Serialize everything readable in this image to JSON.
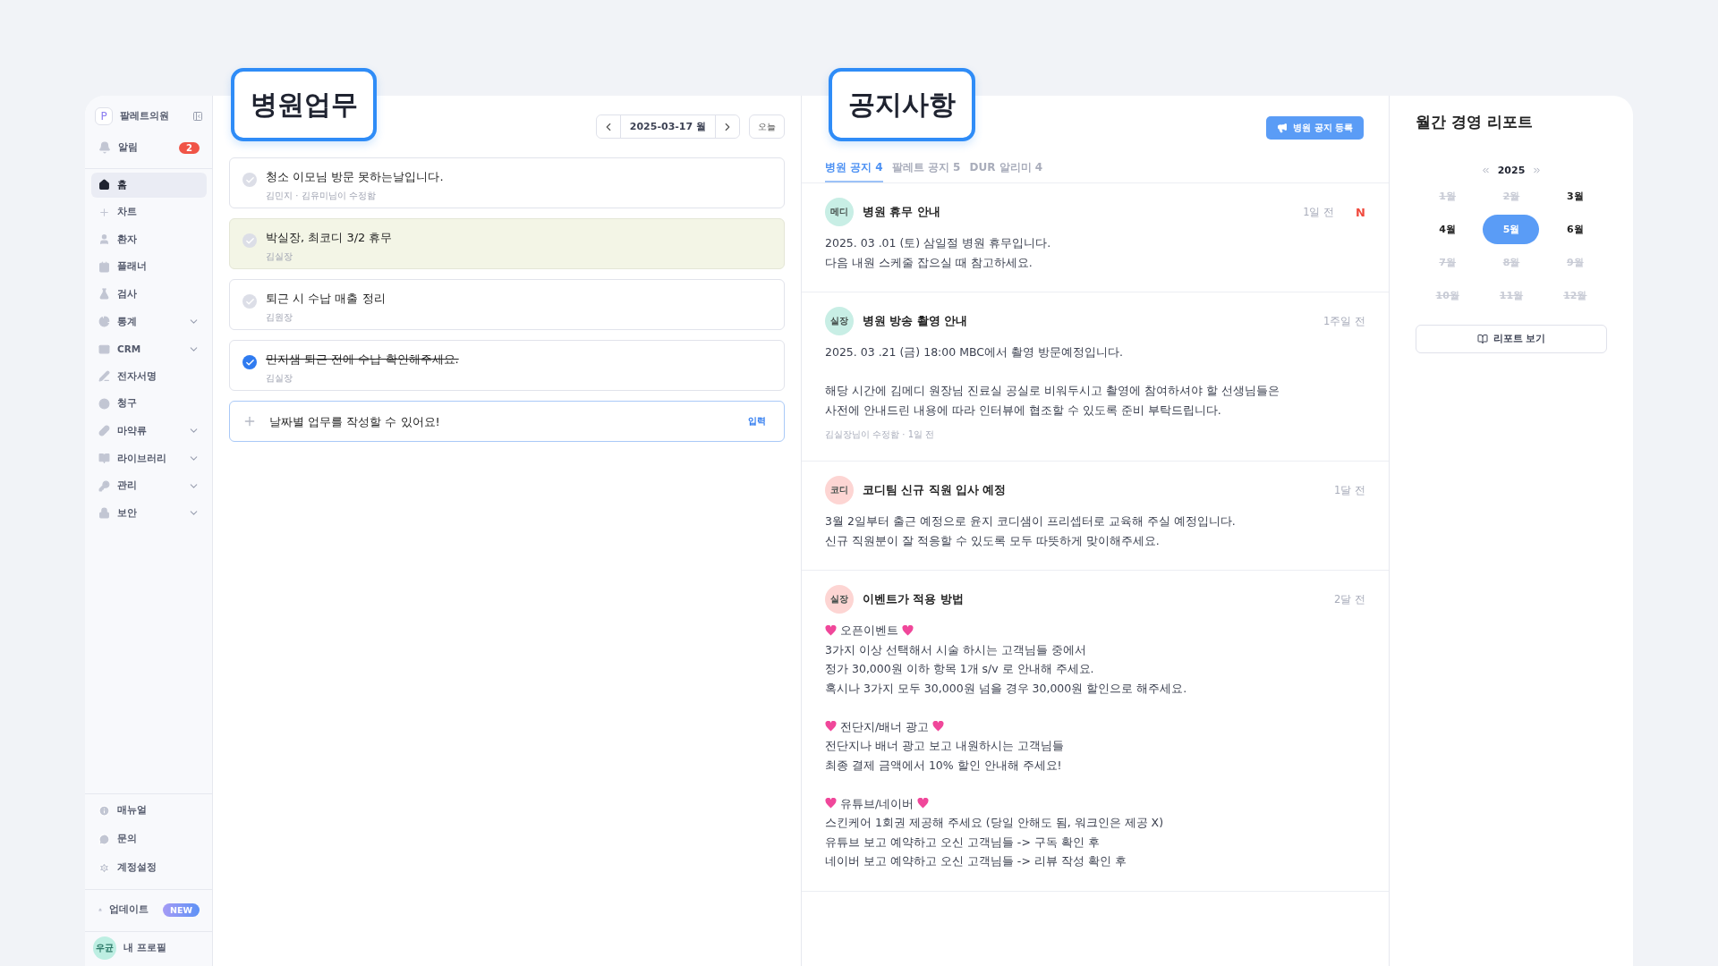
{
  "sidebar": {
    "clinic_name": "팔레트의원",
    "logo_letter": "P",
    "alert": {
      "label": "알림",
      "count": "2"
    },
    "items": [
      {
        "label": "홈",
        "selected": true,
        "expandable": false
      },
      {
        "label": "차트",
        "selected": false,
        "expandable": false
      },
      {
        "label": "환자",
        "selected": false,
        "expandable": false
      },
      {
        "label": "플래너",
        "selected": false,
        "expandable": false
      },
      {
        "label": "검사",
        "selected": false,
        "expandable": false
      },
      {
        "label": "통계",
        "selected": false,
        "expandable": true
      },
      {
        "label": "CRM",
        "selected": false,
        "expandable": true
      },
      {
        "label": "전자서명",
        "selected": false,
        "expandable": false
      },
      {
        "label": "청구",
        "selected": false,
        "expandable": false
      },
      {
        "label": "마약류",
        "selected": false,
        "expandable": true
      },
      {
        "label": "라이브러리",
        "selected": false,
        "expandable": true
      },
      {
        "label": "관리",
        "selected": false,
        "expandable": true
      },
      {
        "label": "보안",
        "selected": false,
        "expandable": true
      }
    ],
    "bottom_items": [
      {
        "label": "매뉴얼"
      },
      {
        "label": "문의"
      },
      {
        "label": "계정설정"
      }
    ],
    "update": {
      "label": "업데이트",
      "badge": "NEW"
    },
    "profile": {
      "avatar": "우균",
      "label": "내 프로필"
    }
  },
  "tasks": {
    "title": "병원업무",
    "date": "2025-03-17 월",
    "today": "오늘",
    "items": [
      {
        "title": "청소 이모님 방문 못하는날입니다.",
        "meta": "김민지 · 김유미님이 수정함",
        "done": false,
        "highlighted": false
      },
      {
        "title": "박실장, 최코디 3/2 휴무",
        "meta": "김실장",
        "done": false,
        "highlighted": true
      },
      {
        "title": "퇴근 시 수납 매출 정리",
        "meta": "김원장",
        "done": false,
        "highlighted": false
      },
      {
        "title": "민지샘 퇴근 전에 수납 확인해주세요.",
        "meta": "김실장",
        "done": true,
        "highlighted": false
      }
    ],
    "new_task": {
      "placeholder": "날짜별 업무를 작성할 수 있어요!",
      "submit": "입력"
    }
  },
  "notices": {
    "title": "공지사항",
    "register_button": "병원 공지 등록",
    "tabs": [
      {
        "label": "병원 공지 4",
        "selected": true
      },
      {
        "label": "팔레트 공지 5",
        "selected": false
      },
      {
        "label": "DUR 알리미 4",
        "selected": false
      }
    ],
    "items": [
      {
        "author": "메디",
        "color": "#c8eee5",
        "title": "병원 휴무 안내",
        "time": "1일 전",
        "is_new": true,
        "new_mark": "N",
        "lines": [
          {
            "kind": "text",
            "text": "2025. 03 .01 (토) 삼일절 병원 휴무입니다."
          },
          {
            "kind": "text",
            "text": "다음 내원 스케줄 잡으실 때 참고하세요."
          }
        ]
      },
      {
        "author": "실장",
        "color": "#c8eee5",
        "title": "병원 방송 촬영 안내",
        "time": "1주일 전",
        "is_new": false,
        "edited": "김실장님이 수정함 · 1일 전",
        "lines": [
          {
            "kind": "text",
            "text": "2025. 03 .21 (금) 18:00 MBC에서 촬영 방문예정입니다."
          },
          {
            "kind": "blank"
          },
          {
            "kind": "text",
            "text": "해당 시간에 김메디 원장님 진료실 공실로 비워두시고 촬영에 참여하셔야 할 선생님들은"
          },
          {
            "kind": "text",
            "text": "사전에 안내드린 내용에 따라 인터뷰에 협조할 수 있도록 준비 부탁드립니다."
          }
        ]
      },
      {
        "author": "코디",
        "color": "#fdd5d3",
        "title": "코디팀 신규 직원 입사 예정",
        "time": "1달 전",
        "is_new": false,
        "lines": [
          {
            "kind": "text",
            "text": "3월 2일부터 출근 예정으로 윤지 코디샘이 프리셉터로 교육해 주실 예정입니다."
          },
          {
            "kind": "text",
            "text": "신규 직원분이 잘 적응할 수 있도록 모두 따뜻하게 맞이해주세요."
          }
        ]
      },
      {
        "author": "실장",
        "color": "#fdd5d3",
        "title": "이벤트가 적용 방법",
        "time": "2달 전",
        "is_new": false,
        "lines": [
          {
            "kind": "heading",
            "text": "오픈이벤트"
          },
          {
            "kind": "text",
            "text": "3가지 이상 선택해서 시술 하시는 고객님들 중에서"
          },
          {
            "kind": "text",
            "text": "정가 30,000원 이하 항목 1개 s/v 로 안내해 주세요."
          },
          {
            "kind": "text",
            "text": "혹시나 3가지 모두 30,000원 넘을 경우 30,000원 할인으로 해주세요."
          },
          {
            "kind": "blank"
          },
          {
            "kind": "heading",
            "text": "전단지/배너 광고"
          },
          {
            "kind": "text",
            "text": "전단지나 배너 광고 보고 내원하시는 고객님들"
          },
          {
            "kind": "text",
            "text": "최종 결제 금액에서 10% 할인 안내해 주세요!"
          },
          {
            "kind": "blank"
          },
          {
            "kind": "heading",
            "text": "유튜브/네이버"
          },
          {
            "kind": "text",
            "text": "스킨케어 1회권 제공해 주세요 (당일 안해도 됨, 워크인은 제공 X)"
          },
          {
            "kind": "text",
            "text": "유튜브 보고 예약하고 오신 고객님들 -> 구독 확인 후"
          },
          {
            "kind": "text",
            "text": "네이버 보고 예약하고 오신 고객님들 -> 리뷰 작성 확인 후"
          }
        ]
      }
    ]
  },
  "report": {
    "title": "월간 경영 리포트",
    "year": "2025",
    "months": [
      {
        "label": "1월",
        "selected": false,
        "disabled": true
      },
      {
        "label": "2월",
        "selected": false,
        "disabled": true
      },
      {
        "label": "3월",
        "selected": false,
        "disabled": false
      },
      {
        "label": "4월",
        "selected": false,
        "disabled": false
      },
      {
        "label": "5월",
        "selected": true,
        "disabled": false
      },
      {
        "label": "6월",
        "selected": false,
        "disabled": false
      },
      {
        "label": "7월",
        "selected": false,
        "disabled": true
      },
      {
        "label": "8월",
        "selected": false,
        "disabled": true
      },
      {
        "label": "9월",
        "selected": false,
        "disabled": true
      },
      {
        "label": "10월",
        "selected": false,
        "disabled": true
      },
      {
        "label": "11월",
        "selected": false,
        "disabled": true
      },
      {
        "label": "12월",
        "selected": false,
        "disabled": true
      }
    ],
    "view_button": "리포트 보기"
  }
}
